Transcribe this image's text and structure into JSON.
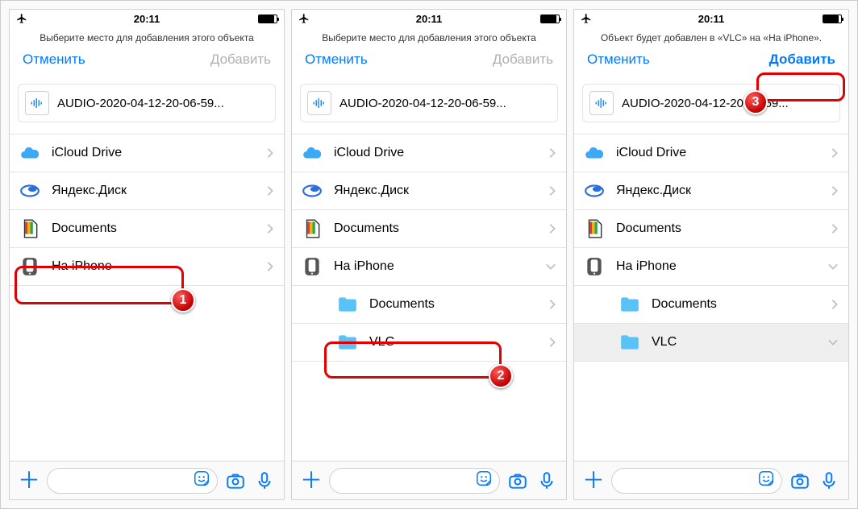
{
  "status": {
    "time": "20:11"
  },
  "screens": [
    {
      "prompt": "Выберите место для добавления этого объекта",
      "cancel": "Отменить",
      "add": "Добавить",
      "add_active": false,
      "file_name": "AUDIO-2020-04-12-20-06-59...",
      "locations": {
        "icloud": "iCloud Drive",
        "yandex": "Яндекс.Диск",
        "documents": "Documents",
        "on_iphone": "На iPhone"
      },
      "expanded": false,
      "subfolders": {},
      "highlight": "on_iphone",
      "badge": "1"
    },
    {
      "prompt": "Выберите место для добавления этого объекта",
      "cancel": "Отменить",
      "add": "Добавить",
      "add_active": false,
      "file_name": "AUDIO-2020-04-12-20-06-59...",
      "locations": {
        "icloud": "iCloud Drive",
        "yandex": "Яндекс.Диск",
        "documents": "Documents",
        "on_iphone": "На iPhone"
      },
      "expanded": true,
      "subfolders": {
        "documents": "Documents",
        "vlc": "VLC"
      },
      "highlight": "vlc",
      "badge": "2"
    },
    {
      "prompt": "Объект будет добавлен в «VLC» на «На iPhone».",
      "cancel": "Отменить",
      "add": "Добавить",
      "add_active": true,
      "file_name": "AUDIO-2020-04-12-20-06-59...",
      "locations": {
        "icloud": "iCloud Drive",
        "yandex": "Яндекс.Диск",
        "documents": "Documents",
        "on_iphone": "На iPhone"
      },
      "expanded": true,
      "subfolders": {
        "documents": "Documents",
        "vlc": "VLC"
      },
      "vlc_selected": true,
      "highlight": "add",
      "badge": "3"
    }
  ]
}
